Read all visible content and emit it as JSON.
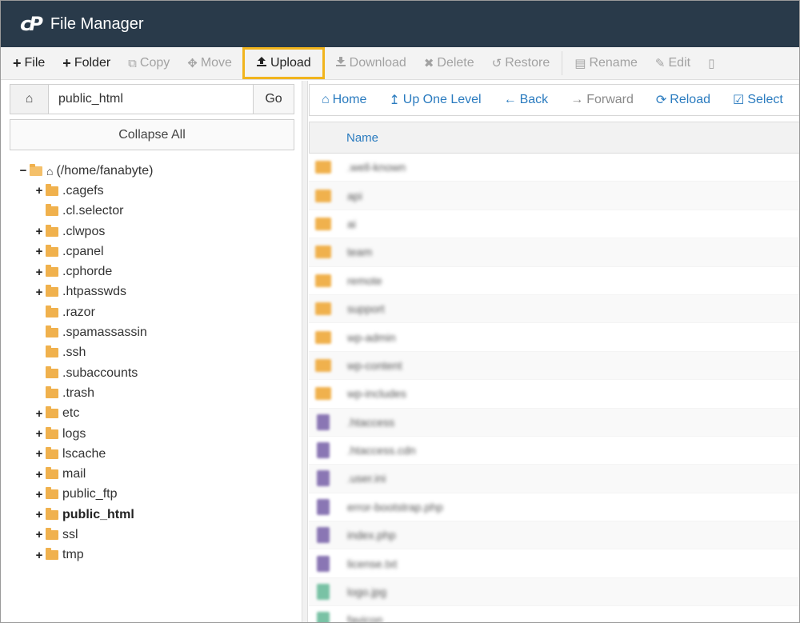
{
  "app": {
    "logo": "cP",
    "title": "File Manager"
  },
  "toolbar": {
    "buttons": [
      {
        "label": "File",
        "icon": "+",
        "state": "enabled"
      },
      {
        "label": "Folder",
        "icon": "+",
        "state": "enabled"
      },
      {
        "label": "Copy",
        "icon": "⧉",
        "state": "disabled"
      },
      {
        "label": "Move",
        "icon": "✥",
        "state": "disabled"
      },
      {
        "label": "Upload",
        "icon": "⭱",
        "state": "highlighted"
      },
      {
        "label": "Download",
        "icon": "⭳",
        "state": "disabled"
      },
      {
        "label": "Delete",
        "icon": "✖",
        "state": "disabled"
      },
      {
        "label": "Restore",
        "icon": "↺",
        "state": "disabled"
      },
      {
        "label": "Rename",
        "icon": "▤",
        "state": "disabled"
      },
      {
        "label": "Edit",
        "icon": "✎",
        "state": "disabled"
      }
    ],
    "highlight_color": "#f1b41d"
  },
  "path_bar": {
    "value": "public_html",
    "go_label": "Go"
  },
  "collapse_label": "Collapse All",
  "tree": {
    "root": "(/home/fanabyte)",
    "items": [
      {
        "label": ".cagefs",
        "expandable": true
      },
      {
        "label": ".cl.selector",
        "expandable": false
      },
      {
        "label": ".clwpos",
        "expandable": true
      },
      {
        "label": ".cpanel",
        "expandable": true
      },
      {
        "label": ".cphorde",
        "expandable": true
      },
      {
        "label": ".htpasswds",
        "expandable": true
      },
      {
        "label": ".razor",
        "expandable": false
      },
      {
        "label": ".spamassassin",
        "expandable": false
      },
      {
        "label": ".ssh",
        "expandable": false
      },
      {
        "label": ".subaccounts",
        "expandable": false
      },
      {
        "label": ".trash",
        "expandable": false
      },
      {
        "label": "etc",
        "expandable": true
      },
      {
        "label": "logs",
        "expandable": true
      },
      {
        "label": "lscache",
        "expandable": true
      },
      {
        "label": "mail",
        "expandable": true
      },
      {
        "label": "public_ftp",
        "expandable": true
      },
      {
        "label": "public_html",
        "expandable": true,
        "selected": true
      },
      {
        "label": "ssl",
        "expandable": true
      },
      {
        "label": "tmp",
        "expandable": true
      }
    ]
  },
  "nav": {
    "home": "Home",
    "up": "Up One Level",
    "back": "Back",
    "forward": "Forward",
    "reload": "Reload",
    "select": "Select"
  },
  "file_list": {
    "column_name": "Name",
    "rows": [
      {
        "type": "folder",
        "name": ".well-known"
      },
      {
        "type": "folder",
        "name": "api"
      },
      {
        "type": "folder",
        "name": "ai"
      },
      {
        "type": "folder",
        "name": "team"
      },
      {
        "type": "folder",
        "name": "remote"
      },
      {
        "type": "folder",
        "name": "support"
      },
      {
        "type": "folder",
        "name": "wp-admin"
      },
      {
        "type": "folder",
        "name": "wp-content"
      },
      {
        "type": "folder",
        "name": "wp-includes"
      },
      {
        "type": "text",
        "name": ".htaccess"
      },
      {
        "type": "text",
        "name": ".htaccess.cdn"
      },
      {
        "type": "text",
        "name": ".user.ini"
      },
      {
        "type": "text",
        "name": "error-bootstrap.php"
      },
      {
        "type": "text",
        "name": "index.php"
      },
      {
        "type": "text",
        "name": "license.txt"
      },
      {
        "type": "image",
        "name": "logo.jpg"
      },
      {
        "type": "image",
        "name": "favicon"
      }
    ]
  }
}
